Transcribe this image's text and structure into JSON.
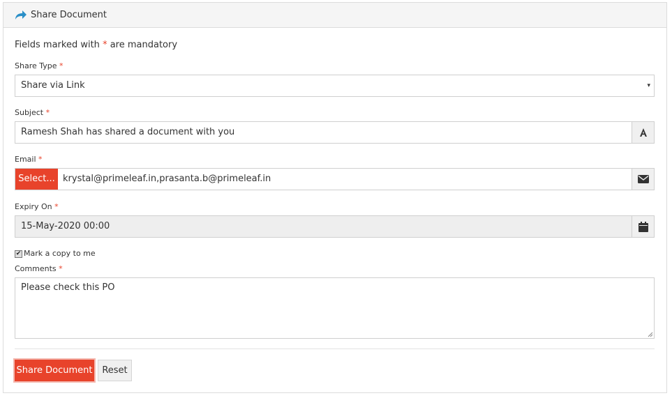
{
  "panel": {
    "title": "Share Document",
    "title_icon": "share-icon"
  },
  "form": {
    "mandatory_note_prefix": "Fields marked with",
    "mandatory_star": "*",
    "mandatory_note_suffix": "are mandatory",
    "share_type": {
      "label": "Share Type",
      "value": "Share via Link",
      "arrow": "▾"
    },
    "subject": {
      "label": "Subject",
      "value": "Ramesh Shah has shared a document with you",
      "addon_icon": "font-icon"
    },
    "email": {
      "label": "Email",
      "select_button": "Select...",
      "value": "krystal@primeleaf.in,prasanta.b@primeleaf.in",
      "addon_icon": "envelope-icon"
    },
    "expiry": {
      "label": "Expiry On",
      "value": "15-May-2020 00:00",
      "addon_icon": "calendar-icon"
    },
    "copy_checkbox": {
      "label": "Mark a copy to me",
      "checked": true
    },
    "comments": {
      "label": "Comments",
      "value": "Please check this PO"
    }
  },
  "buttons": {
    "share": "Share Document",
    "reset": "Reset"
  },
  "colors": {
    "accent": "#e8432b",
    "share_icon": "#2a8fc7"
  }
}
